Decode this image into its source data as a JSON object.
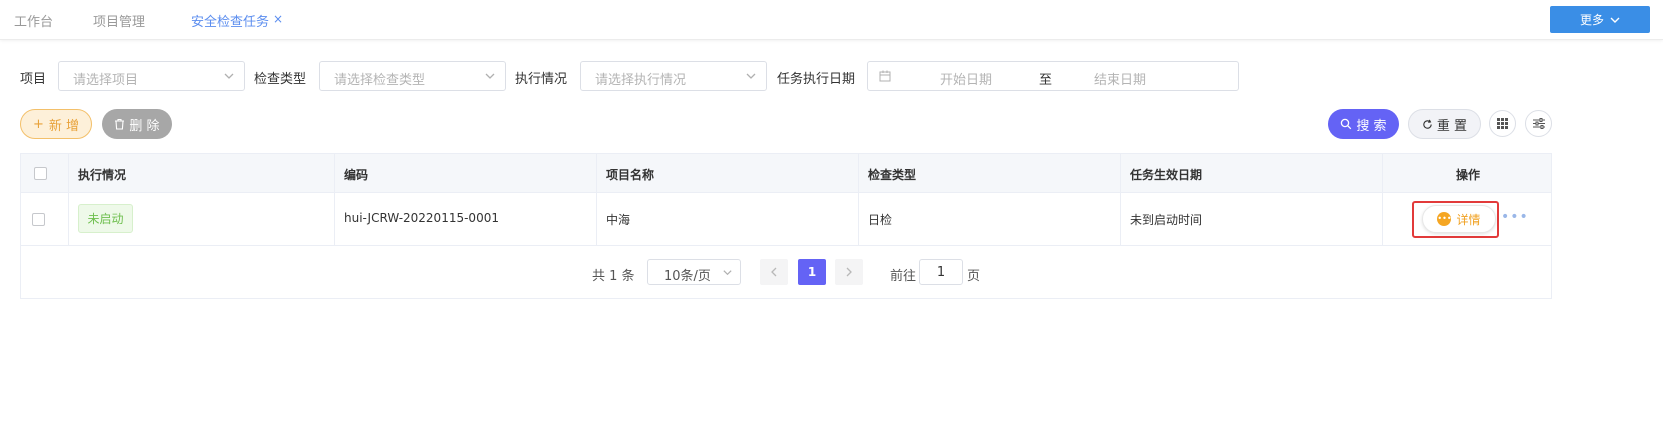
{
  "tabs": [
    {
      "label": "工作台"
    },
    {
      "label": "项目管理"
    },
    {
      "label": "安全检查任务",
      "close": "×"
    }
  ],
  "more_button": {
    "label": "更多"
  },
  "filters": {
    "project": {
      "label": "项目",
      "placeholder": "请选择项目"
    },
    "check_type": {
      "label": "检查类型",
      "placeholder": "请选择检查类型"
    },
    "status": {
      "label": "执行情况",
      "placeholder": "请选择执行情况"
    },
    "date": {
      "label": "任务执行日期",
      "start_placeholder": "开始日期",
      "separator": "至",
      "end_placeholder": "结束日期"
    }
  },
  "actions": {
    "add_icon": "+",
    "add_label": "新 增",
    "delete_label": "删 除",
    "search_label": "搜 索",
    "reset_label": "重 置"
  },
  "table": {
    "columns": [
      "执行情况",
      "编码",
      "项目名称",
      "检查类型",
      "任务生效日期",
      "操作"
    ],
    "rows": [
      {
        "status": "未启动",
        "code": "hui-JCRW-20220115-0001",
        "project": "中海",
        "check_type": "日检",
        "effective_date": "未到启动时间",
        "detail_label": "详情",
        "more": "•••"
      }
    ]
  },
  "pagination": {
    "total_text": "共 1 条",
    "page_size": "10条/页",
    "current_page": "1",
    "goto_label": "前往",
    "goto_value": "1",
    "page_suffix": "页"
  },
  "colors": {
    "accent": "#6463f5",
    "tab_active": "#5b8def",
    "more_button": "#3a8ee6",
    "add_button": "#fdf0d9",
    "status_ok": "#6fbf4f",
    "highlight": "#e23a3a"
  }
}
